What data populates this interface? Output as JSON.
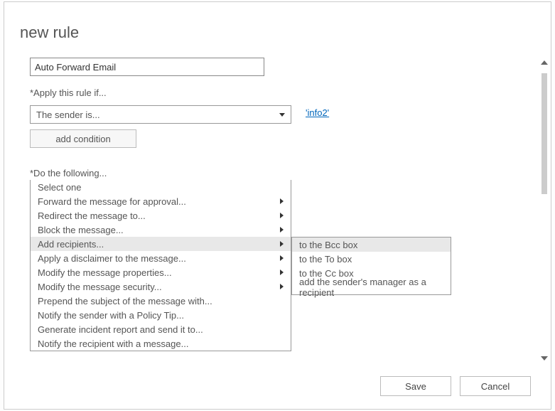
{
  "title": "new rule",
  "rule_name": "Auto Forward Email",
  "apply_label": "*Apply this rule if...",
  "apply_selected": "The sender is...",
  "apply_pill": "'info2'",
  "add_condition_label": "add condition",
  "do_label": "*Do the following...",
  "do_selected": "Select one",
  "do_options": [
    {
      "label": "Select one",
      "has_sub": false
    },
    {
      "label": "Forward the message for approval...",
      "has_sub": true
    },
    {
      "label": "Redirect the message to...",
      "has_sub": true
    },
    {
      "label": "Block the message...",
      "has_sub": true
    },
    {
      "label": "Add recipients...",
      "has_sub": true,
      "highlight": true
    },
    {
      "label": "Apply a disclaimer to the message...",
      "has_sub": true
    },
    {
      "label": "Modify the message properties...",
      "has_sub": true
    },
    {
      "label": "Modify the message security...",
      "has_sub": true
    },
    {
      "label": "Prepend the subject of the message with...",
      "has_sub": false
    },
    {
      "label": "Notify the sender with a Policy Tip...",
      "has_sub": false
    },
    {
      "label": "Generate incident report and send it to...",
      "has_sub": false
    },
    {
      "label": "Notify the recipient with a message...",
      "has_sub": false
    }
  ],
  "submenu": [
    {
      "label": "to the Bcc box",
      "highlight": true
    },
    {
      "label": "to the To box"
    },
    {
      "label": "to the Cc box"
    },
    {
      "label": "add the sender's manager as a recipient"
    }
  ],
  "save_label": "Save",
  "cancel_label": "Cancel"
}
